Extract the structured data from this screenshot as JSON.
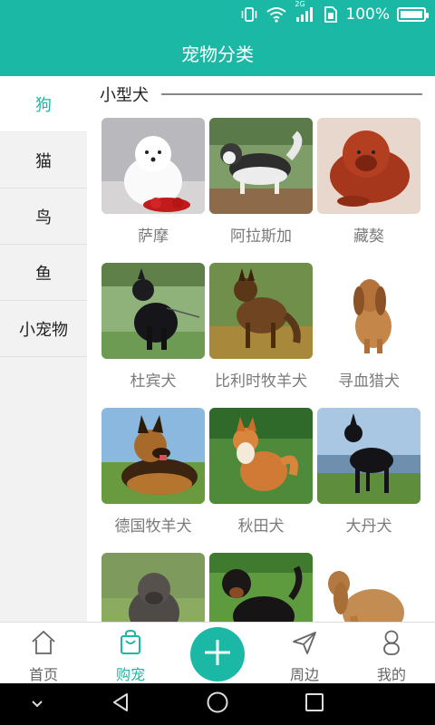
{
  "status_bar": {
    "battery_text": "100%",
    "network_label": "2G"
  },
  "header": {
    "title": "宠物分类"
  },
  "sidebar": {
    "items": [
      {
        "label": "狗",
        "active": true
      },
      {
        "label": "猫",
        "active": false
      },
      {
        "label": "鸟",
        "active": false
      },
      {
        "label": "鱼",
        "active": false
      },
      {
        "label": "小宠物",
        "active": false
      }
    ]
  },
  "section": {
    "title": "小型犬"
  },
  "breeds": [
    {
      "name": "萨摩"
    },
    {
      "name": "阿拉斯加"
    },
    {
      "name": "藏獒"
    },
    {
      "name": "杜宾犬"
    },
    {
      "name": "比利时牧羊犬"
    },
    {
      "name": "寻血猎犬"
    },
    {
      "name": "德国牧羊犬"
    },
    {
      "name": "秋田犬"
    },
    {
      "name": "大丹犬"
    },
    {
      "name": ""
    },
    {
      "name": ""
    },
    {
      "name": ""
    }
  ],
  "tabbar": {
    "tabs": [
      {
        "label": "首页",
        "icon": "home-icon"
      },
      {
        "label": "购宠",
        "icon": "shopping-bag-icon",
        "active": true
      },
      {
        "label": "周边",
        "icon": "send-icon"
      },
      {
        "label": "我的",
        "icon": "user-icon"
      }
    ],
    "add_icon": "plus-icon"
  },
  "navbar": {
    "icons": [
      "chevron-down-icon",
      "back-icon",
      "home-circle-icon",
      "recents-icon"
    ]
  },
  "colors": {
    "primary": "#1bb9a5",
    "sidebar_bg": "#f2f2f2",
    "label_gray": "#7a7a7a"
  }
}
